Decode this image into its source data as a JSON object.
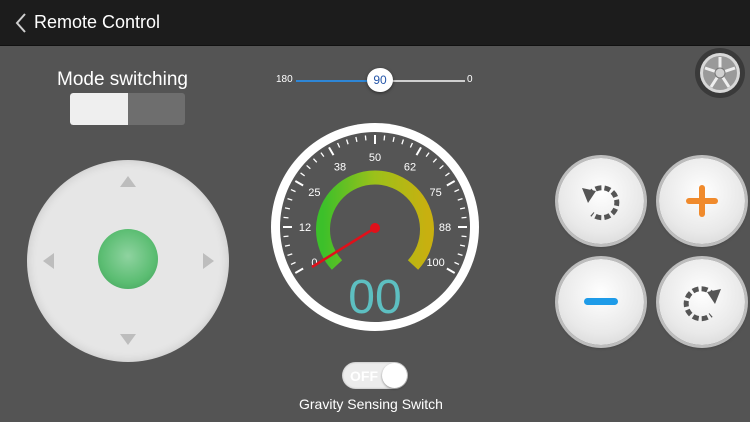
{
  "header": {
    "title": "Remote Control",
    "back_icon": "chevron-left-icon"
  },
  "mode": {
    "label": "Mode switching",
    "state": "left"
  },
  "slider": {
    "min_label": "180",
    "max_label": "0",
    "value": "90",
    "accent": "#2e86d6"
  },
  "gauge": {
    "ticks": [
      "0",
      "12",
      "25",
      "38",
      "50",
      "62",
      "75",
      "88",
      "100"
    ],
    "readout": "00",
    "readout_color": "#5dbfc1",
    "needle_color": "#e0101a"
  },
  "controls": {
    "rotate_left_icon": "rotate-ccw-icon",
    "plus_icon": "plus-icon",
    "minus_icon": "minus-icon",
    "rotate_right_icon": "rotate-cw-icon",
    "plus_color": "#f08a2c",
    "minus_color": "#1e9be8"
  },
  "gravity": {
    "toggle_text": "OFF",
    "label": "Gravity Sensing Switch"
  }
}
